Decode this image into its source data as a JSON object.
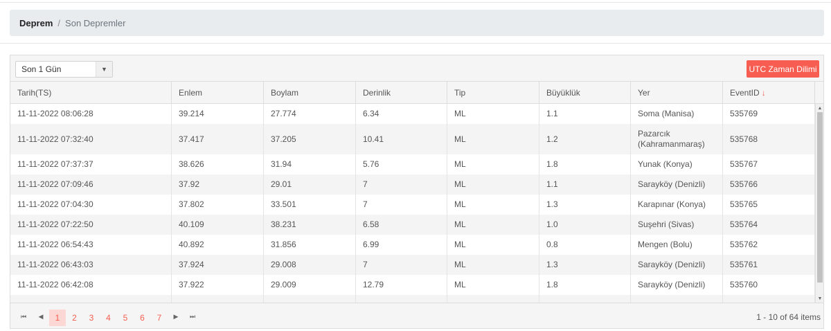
{
  "breadcrumb": {
    "root": "Deprem",
    "separator": "/",
    "current": "Son Depremler"
  },
  "toolbar": {
    "filter_value": "Son 1 Gün",
    "utc_button": "UTC Zaman Dilimi"
  },
  "table": {
    "columns": [
      "Tarih(TS)",
      "Enlem",
      "Boylam",
      "Derinlik",
      "Tip",
      "Büyüklük",
      "Yer",
      "EventID"
    ],
    "sort_indicator": "↓",
    "rows": [
      [
        "11-11-2022 08:06:28",
        "39.214",
        "27.774",
        "6.34",
        "ML",
        "1.1",
        "Soma (Manisa)",
        "535769"
      ],
      [
        "11-11-2022 07:32:40",
        "37.417",
        "37.205",
        "10.41",
        "ML",
        "1.2",
        "Pazarcık (Kahramanmaraş)",
        "535768"
      ],
      [
        "11-11-2022 07:37:37",
        "38.626",
        "31.94",
        "5.76",
        "ML",
        "1.8",
        "Yunak (Konya)",
        "535767"
      ],
      [
        "11-11-2022 07:09:46",
        "37.92",
        "29.01",
        "7",
        "ML",
        "1.1",
        "Sarayköy (Denizli)",
        "535766"
      ],
      [
        "11-11-2022 07:04:30",
        "37.802",
        "33.501",
        "7",
        "ML",
        "1.3",
        "Karapınar (Konya)",
        "535765"
      ],
      [
        "11-11-2022 07:22:50",
        "40.109",
        "38.231",
        "6.58",
        "ML",
        "1.0",
        "Suşehri (Sivas)",
        "535764"
      ],
      [
        "11-11-2022 06:54:43",
        "40.892",
        "31.856",
        "6.99",
        "ML",
        "0.8",
        "Mengen (Bolu)",
        "535762"
      ],
      [
        "11-11-2022 06:43:03",
        "37.924",
        "29.008",
        "7",
        "ML",
        "1.3",
        "Sarayköy (Denizli)",
        "535761"
      ],
      [
        "11-11-2022 06:42:08",
        "37.922",
        "29.009",
        "12.79",
        "ML",
        "1.8",
        "Sarayköy (Denizli)",
        "535760"
      ]
    ]
  },
  "pager": {
    "pages": [
      "1",
      "2",
      "3",
      "4",
      "5",
      "6",
      "7"
    ],
    "active_page": "1",
    "info": "1 - 10 of 64 items"
  },
  "colors": {
    "accent": "#f75e51",
    "active_page_bg": "#fcd7d3"
  }
}
